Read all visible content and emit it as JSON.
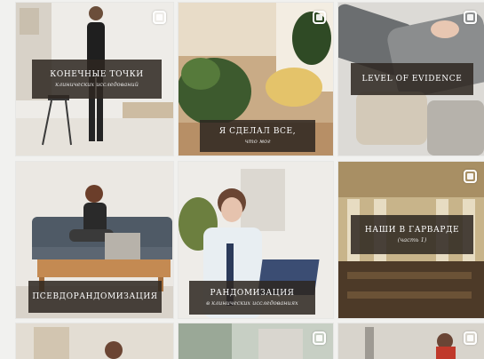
{
  "posts": [
    {
      "title": "КОНЕЧНЫЕ ТОЧКИ",
      "subtitle": "клинических исследований",
      "icon": "multiple-images-icon"
    },
    {
      "title": "Я СДЕЛАЛ ВСЕ,",
      "subtitle": "что мог",
      "icon": "multiple-images-icon"
    },
    {
      "title": "LEVEL OF EVIDENCE",
      "subtitle": "",
      "icon": "multiple-images-icon"
    },
    {
      "title": "ПСЕВДОРАНДОМИЗАЦИЯ",
      "subtitle": "",
      "icon": "multiple-images-icon"
    },
    {
      "title": "РАНДОМИЗАЦИЯ",
      "subtitle": "в клинических исследованиях",
      "icon": "multiple-images-icon"
    },
    {
      "title": "НАШИ В ГАРВАРДЕ",
      "subtitle": "(часть 1)",
      "icon": "multiple-images-icon"
    },
    {
      "title": "",
      "subtitle": "",
      "icon": "multiple-images-icon"
    },
    {
      "title": "",
      "subtitle": "",
      "icon": "multiple-images-icon"
    },
    {
      "title": "",
      "subtitle": "",
      "icon": "multiple-images-icon"
    }
  ],
  "colors": {
    "label_bg": "#2d2621",
    "label_text": "#ffffff",
    "page_bg": "#f1f1ef"
  }
}
